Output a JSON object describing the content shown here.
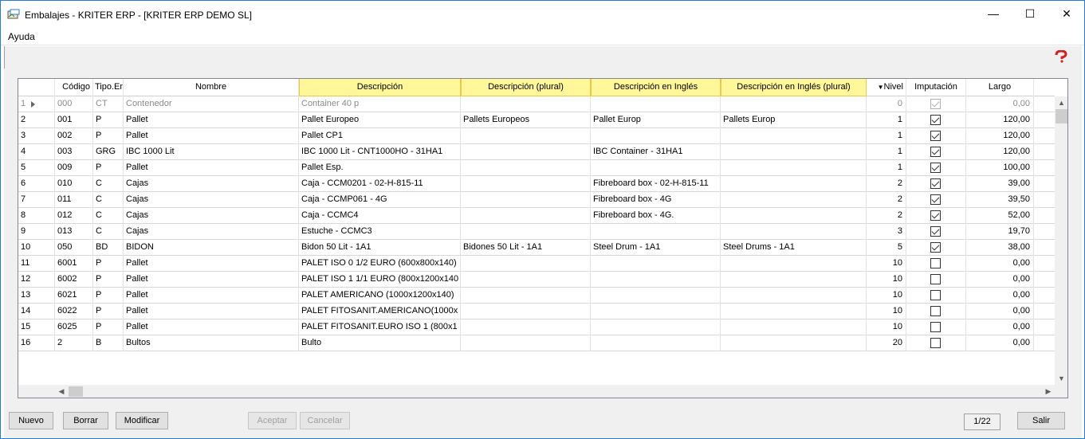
{
  "window": {
    "title": "Embalajes - KRITER ERP - [KRITER ERP DEMO SL]",
    "minimize_glyph": "—",
    "maximize_glyph": "☐",
    "close_glyph": "✕"
  },
  "menu": {
    "items": [
      "Ayuda"
    ]
  },
  "grid": {
    "columns": {
      "codigo": "Código",
      "tipo": "Tipo.Emb.",
      "nombre": "Nombre",
      "descripcion": "Descripción",
      "descripcion_plural": "Descripción (plural)",
      "descripcion_ingles": "Descripción en Inglés",
      "descripcion_ingles_plural": "Descripción en Inglés (plural)",
      "nivel": "Nivel",
      "imputacion": "Imputación",
      "largo": "Largo"
    },
    "sort_indicator": "▼",
    "rows": [
      {
        "n": "1",
        "codigo": "000",
        "tipo": "CT",
        "nombre": "Contenedor",
        "desc": "Container 40 p",
        "desc_pl": "",
        "desc_en": "",
        "desc_en_pl": "",
        "nivel": "0",
        "imput": true,
        "largo": "0,00"
      },
      {
        "n": "2",
        "codigo": "001",
        "tipo": "P",
        "nombre": "Pallet",
        "desc": "Pallet Europeo",
        "desc_pl": "Pallets Europeos",
        "desc_en": "Pallet Europ",
        "desc_en_pl": "Pallets Europ",
        "nivel": "1",
        "imput": true,
        "largo": "120,00"
      },
      {
        "n": "3",
        "codigo": "002",
        "tipo": "P",
        "nombre": "Pallet",
        "desc": "Pallet CP1",
        "desc_pl": "",
        "desc_en": "",
        "desc_en_pl": "",
        "nivel": "1",
        "imput": true,
        "largo": "120,00"
      },
      {
        "n": "4",
        "codigo": "003",
        "tipo": "GRG",
        "nombre": "IBC 1000 Lit",
        "desc": "IBC 1000 Lit - CNT1000HO - 31HA1",
        "desc_pl": "",
        "desc_en": "IBC Container - 31HA1",
        "desc_en_pl": "",
        "nivel": "1",
        "imput": true,
        "largo": "120,00"
      },
      {
        "n": "5",
        "codigo": "009",
        "tipo": "P",
        "nombre": "Pallet",
        "desc": "Pallet Esp.",
        "desc_pl": "",
        "desc_en": "",
        "desc_en_pl": "",
        "nivel": "1",
        "imput": true,
        "largo": "100,00"
      },
      {
        "n": "6",
        "codigo": "010",
        "tipo": "C",
        "nombre": "Cajas",
        "desc": "Caja - CCM0201 - 02-H-815-11",
        "desc_pl": "",
        "desc_en": "Fibreboard box - 02-H-815-11",
        "desc_en_pl": "",
        "nivel": "2",
        "imput": true,
        "largo": "39,00"
      },
      {
        "n": "7",
        "codigo": "011",
        "tipo": "C",
        "nombre": "Cajas",
        "desc": "Caja - CCMP061 - 4G",
        "desc_pl": "",
        "desc_en": "Fibreboard box - 4G",
        "desc_en_pl": "",
        "nivel": "2",
        "imput": true,
        "largo": "39,50"
      },
      {
        "n": "8",
        "codigo": "012",
        "tipo": "C",
        "nombre": "Cajas",
        "desc": "Caja - CCMC4",
        "desc_pl": "",
        "desc_en": "Fibreboard box - 4G.",
        "desc_en_pl": "",
        "nivel": "2",
        "imput": true,
        "largo": "52,00"
      },
      {
        "n": "9",
        "codigo": "013",
        "tipo": "C",
        "nombre": "Cajas",
        "desc": "Estuche - CCMC3",
        "desc_pl": "",
        "desc_en": "",
        "desc_en_pl": "",
        "nivel": "3",
        "imput": true,
        "largo": "19,70"
      },
      {
        "n": "10",
        "codigo": "050",
        "tipo": "BD",
        "nombre": "BIDON",
        "desc": "Bidon 50 Lit - 1A1",
        "desc_pl": "Bidones 50 Lit - 1A1",
        "desc_en": "Steel Drum - 1A1",
        "desc_en_pl": "Steel Drums - 1A1",
        "nivel": "5",
        "imput": true,
        "largo": "38,00"
      },
      {
        "n": "11",
        "codigo": "6001",
        "tipo": "P",
        "nombre": "Pallet",
        "desc": "PALET ISO 0 1/2 EURO (600x800x140)",
        "desc_pl": "",
        "desc_en": "",
        "desc_en_pl": "",
        "nivel": "10",
        "imput": false,
        "largo": "0,00"
      },
      {
        "n": "12",
        "codigo": "6002",
        "tipo": "P",
        "nombre": "Pallet",
        "desc": "PALET ISO 1 1/1 EURO (800x1200x140",
        "desc_pl": "",
        "desc_en": "",
        "desc_en_pl": "",
        "nivel": "10",
        "imput": false,
        "largo": "0,00"
      },
      {
        "n": "13",
        "codigo": "6021",
        "tipo": "P",
        "nombre": "Pallet",
        "desc": "PALET AMERICANO (1000x1200x140)",
        "desc_pl": "",
        "desc_en": "",
        "desc_en_pl": "",
        "nivel": "10",
        "imput": false,
        "largo": "0,00"
      },
      {
        "n": "14",
        "codigo": "6022",
        "tipo": "P",
        "nombre": "Pallet",
        "desc": "PALET FITOSANIT.AMERICANO(1000x",
        "desc_pl": "",
        "desc_en": "",
        "desc_en_pl": "",
        "nivel": "10",
        "imput": false,
        "largo": "0,00"
      },
      {
        "n": "15",
        "codigo": "6025",
        "tipo": "P",
        "nombre": "Pallet",
        "desc": "PALET FITOSANIT.EURO ISO 1 (800x1",
        "desc_pl": "",
        "desc_en": "",
        "desc_en_pl": "",
        "nivel": "10",
        "imput": false,
        "largo": "0,00"
      },
      {
        "n": "16",
        "codigo": "2",
        "tipo": "B",
        "nombre": "Bultos",
        "desc": "Bulto",
        "desc_pl": "",
        "desc_en": "",
        "desc_en_pl": "",
        "nivel": "20",
        "imput": false,
        "largo": "0,00"
      }
    ]
  },
  "buttons": {
    "nuevo": "Nuevo",
    "borrar": "Borrar",
    "modificar": "Modificar",
    "aceptar": "Aceptar",
    "cancelar": "Cancelar",
    "salir": "Salir"
  },
  "pager": {
    "text": "1/22"
  },
  "colors": {
    "window_border": "#2b79d7",
    "panel_bg": "#f0f0f0",
    "header_highlight": "#fff79a",
    "help_icon": "#d42020"
  }
}
